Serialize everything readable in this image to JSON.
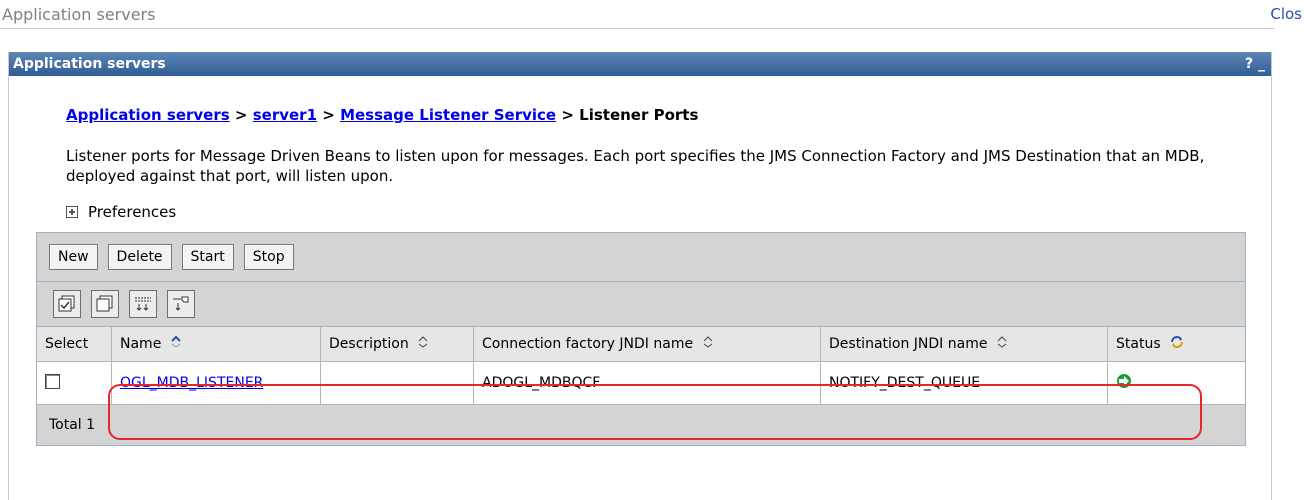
{
  "topbar": {
    "title": "Application servers",
    "close": "Clos"
  },
  "portlet": {
    "title": "Application servers",
    "controls": "? _"
  },
  "breadcrumb": {
    "items": [
      "Application servers",
      "server1",
      "Message Listener Service"
    ],
    "separator": ">",
    "current": "Listener Ports"
  },
  "description": "Listener ports for Message Driven Beans to listen upon for messages. Each port specifies the JMS Connection Factory and JMS Destination that an MDB, deployed against that port, will listen upon.",
  "preferences": {
    "label": "Preferences"
  },
  "toolbar": {
    "buttons": [
      "New",
      "Delete",
      "Start",
      "Stop"
    ]
  },
  "icon_toolbar": {
    "icons": [
      "select-all-icon",
      "deselect-all-icon",
      "show-filter-icon",
      "clear-filter-icon"
    ]
  },
  "table": {
    "headers": [
      "Select",
      "Name",
      "Description",
      "Connection factory JNDI name",
      "Destination JNDI name",
      "Status"
    ],
    "rows": [
      {
        "name": "OGL_MDB_LISTENER",
        "description": "",
        "connection_factory": "ADOGL_MDBQCF",
        "destination": "NOTIFY_DEST_QUEUE",
        "status_icon": "started-arrow-icon"
      }
    ],
    "total": "Total 1"
  },
  "colors": {
    "accent": "#2f5d95",
    "link": "#0000ee",
    "highlight": "#e5262a",
    "status_green": "#1a9a3a"
  }
}
